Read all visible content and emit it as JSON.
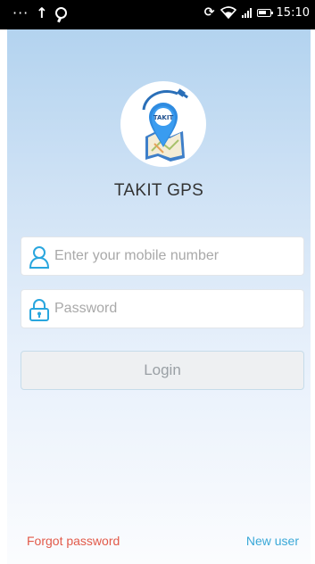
{
  "status_bar": {
    "dots": "···",
    "upload_icon": "arrow-up-icon",
    "time": "15:10"
  },
  "app": {
    "logo_text": "TAKIT",
    "name": "TAKIT GPS"
  },
  "login_form": {
    "mobile_placeholder": "Enter your mobile number",
    "password_placeholder": "Password",
    "login_label": "Login"
  },
  "footer": {
    "forgot_label": "Forgot password",
    "new_user_label": "New user"
  },
  "colors": {
    "accent": "#3aa8d8",
    "forgot": "#e25a4a",
    "icon": "#29a6de"
  }
}
